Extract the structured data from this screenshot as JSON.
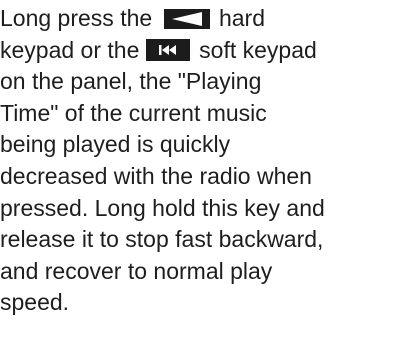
{
  "paragraph": {
    "line1_before": "Long press the ",
    "line1_after": " hard",
    "line2_before": "keypad or the ",
    "line2_after": " soft keypad",
    "line3": "on the panel, the \"Playing",
    "line4": "Time\" of the current music",
    "line5": "being played is quickly",
    "line6": "decreased with the radio when",
    "line7": "pressed. Long hold this key and",
    "line8": "release it to stop fast backward,",
    "line9": "and recover to normal play",
    "line10": "speed."
  },
  "icons": {
    "hard_key": "left-triangle-key-icon",
    "soft_key": "skip-back-key-icon"
  },
  "colors": {
    "text": "#1e1e1e",
    "key_background": "#1c1c1c",
    "key_symbol": "#ffffff"
  }
}
